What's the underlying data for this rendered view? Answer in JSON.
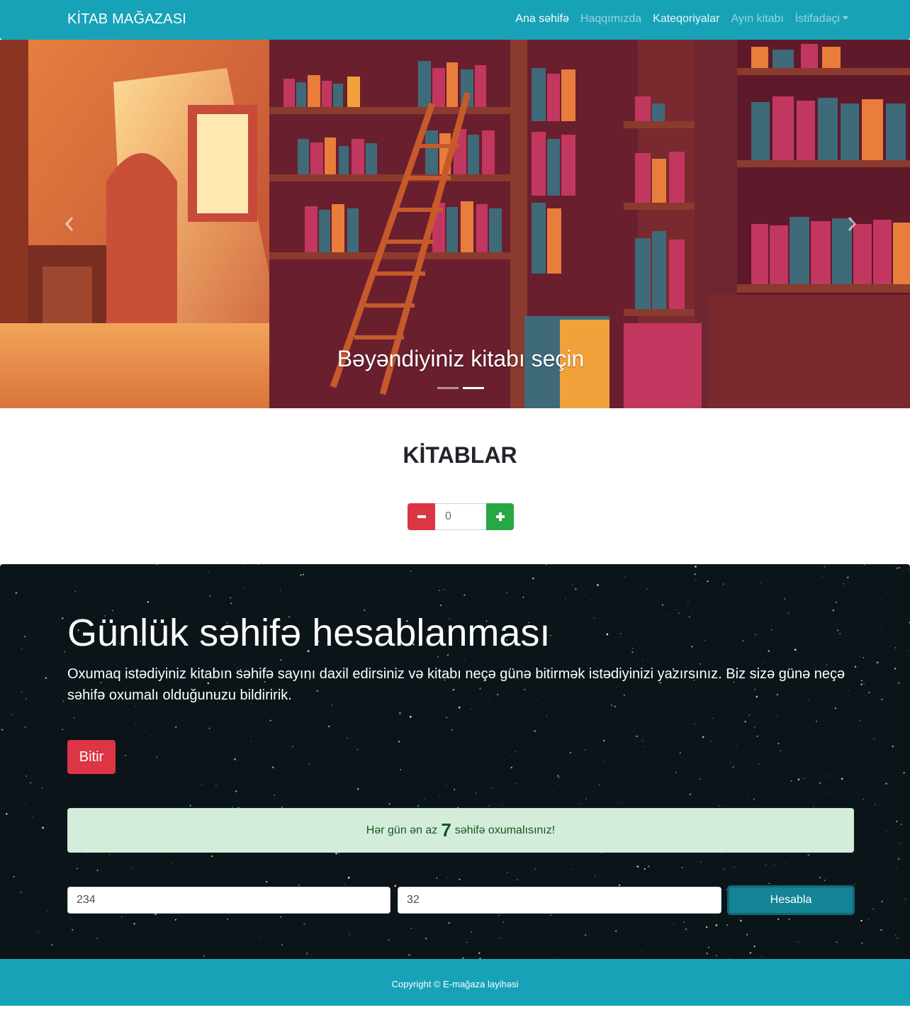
{
  "navbar": {
    "brand": "KİTAB MAĞAZASI",
    "items": [
      {
        "label": "Ana səhifə"
      },
      {
        "label": "Haqqımızda"
      },
      {
        "label": "Kateqoriyalar"
      },
      {
        "label": "Ayın kitabı"
      },
      {
        "label": "İstifadəçi"
      }
    ],
    "color": "#17a2b8"
  },
  "carousel": {
    "caption": "Bəyəndiyiniz kitabı seçin",
    "prev_icon": "chevron-left-icon",
    "next_icon": "chevron-right-icon",
    "active_slide": 2,
    "slide_count": 2
  },
  "books": {
    "title": "KİTABLAR",
    "quantity": "0",
    "minus_icon": "minus-icon",
    "plus_icon": "plus-icon"
  },
  "calculator": {
    "title": "Günlük səhifə hesablanması",
    "lead": "Oxumaq istədiyiniz kitabın səhifə sayını daxil edirsiniz və kitabı neçə günə bitirmək istədiyinizi yazırsınız. Biz sizə günə neçə səhifə oxumalı olduğunuzu bildiririk.",
    "finish_button": "Bitir",
    "result_prefix": "Hər gün ən az",
    "result_value": "7",
    "result_suffix": "səhifə oxumalısınız!",
    "pages_value": "234",
    "days_value": "32",
    "calc_button": "Hesabla"
  },
  "footer": {
    "text": "Copyright © E-mağaza layihəsi"
  }
}
